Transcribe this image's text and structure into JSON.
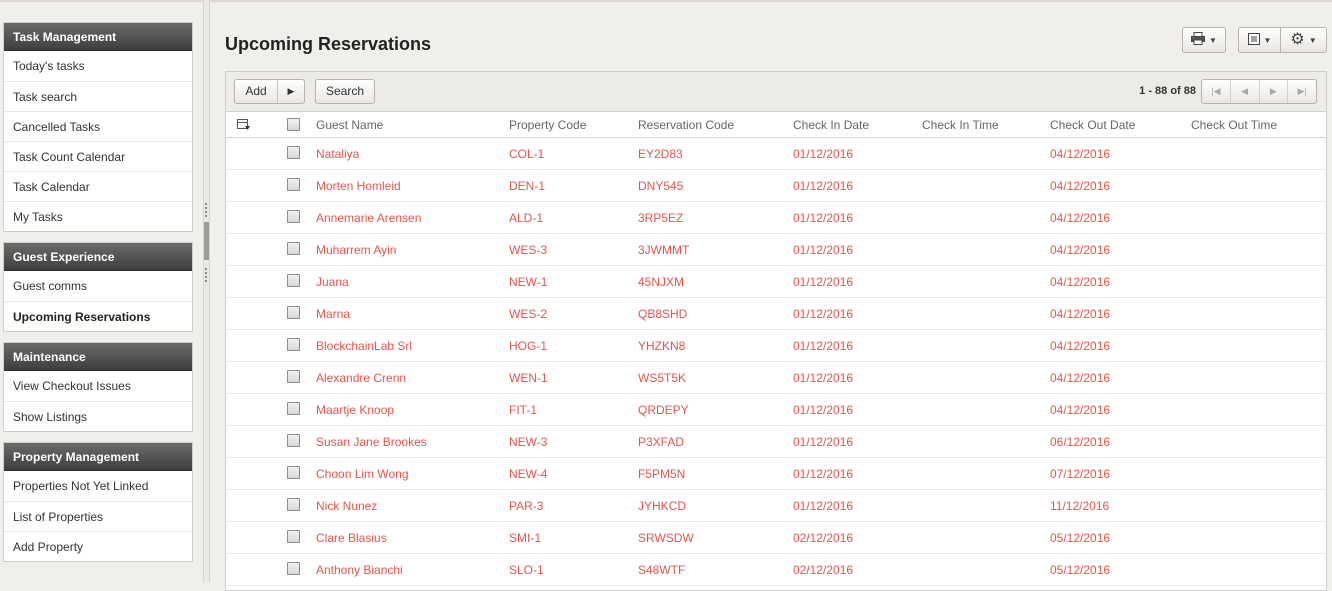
{
  "sidebar": {
    "sections": [
      {
        "title": "Task Management",
        "items": [
          "Today's tasks",
          "Task search",
          "Cancelled Tasks",
          "Task Count Calendar",
          "Task Calendar",
          "My Tasks"
        ]
      },
      {
        "title": "Guest Experience",
        "items": [
          "Guest comms",
          "Upcoming Reservations"
        ]
      },
      {
        "title": "Maintenance",
        "items": [
          "View Checkout Issues",
          "Show Listings"
        ]
      },
      {
        "title": "Property Management",
        "items": [
          "Properties Not Yet Linked",
          "List of Properties",
          "Add Property"
        ]
      }
    ],
    "active_item": "Upcoming Reservations"
  },
  "main": {
    "title": "Upcoming Reservations",
    "toolbar": {
      "add_label": "Add",
      "search_label": "Search"
    },
    "pager": {
      "text": "1 - 88 of 88"
    },
    "columns": [
      "Guest Name",
      "Property Code",
      "Reservation Code",
      "Check In Date",
      "Check In Time",
      "Check Out Date",
      "Check Out Time"
    ],
    "rows": [
      {
        "guest": "Nataliya",
        "property": "COL-1",
        "reservation": "EY2D83",
        "check_in": "01/12/2016",
        "check_in_time": "",
        "check_out": "04/12/2016",
        "check_out_time": ""
      },
      {
        "guest": "Morten Homleid",
        "property": "DEN-1",
        "reservation": "DNY545",
        "check_in": "01/12/2016",
        "check_in_time": "",
        "check_out": "04/12/2016",
        "check_out_time": ""
      },
      {
        "guest": "Annemarie Arensen",
        "property": "ALD-1",
        "reservation": "3RP5EZ",
        "check_in": "01/12/2016",
        "check_in_time": "",
        "check_out": "04/12/2016",
        "check_out_time": ""
      },
      {
        "guest": "Muharrem Ayin",
        "property": "WES-3",
        "reservation": "3JWMMT",
        "check_in": "01/12/2016",
        "check_in_time": "",
        "check_out": "04/12/2016",
        "check_out_time": ""
      },
      {
        "guest": "Juana",
        "property": "NEW-1",
        "reservation": "45NJXM",
        "check_in": "01/12/2016",
        "check_in_time": "",
        "check_out": "04/12/2016",
        "check_out_time": ""
      },
      {
        "guest": "Marna",
        "property": "WES-2",
        "reservation": "QB8SHD",
        "check_in": "01/12/2016",
        "check_in_time": "",
        "check_out": "04/12/2016",
        "check_out_time": ""
      },
      {
        "guest": "BlockchainLab Srl",
        "property": "HOG-1",
        "reservation": "YHZKN8",
        "check_in": "01/12/2016",
        "check_in_time": "",
        "check_out": "04/12/2016",
        "check_out_time": ""
      },
      {
        "guest": "Alexandre Crenn",
        "property": "WEN-1",
        "reservation": "WS5T5K",
        "check_in": "01/12/2016",
        "check_in_time": "",
        "check_out": "04/12/2016",
        "check_out_time": ""
      },
      {
        "guest": "Maartje Knoop",
        "property": "FIT-1",
        "reservation": "QRDEPY",
        "check_in": "01/12/2016",
        "check_in_time": "",
        "check_out": "04/12/2016",
        "check_out_time": ""
      },
      {
        "guest": "Susan Jane Brookes",
        "property": "NEW-3",
        "reservation": "P3XFAD",
        "check_in": "01/12/2016",
        "check_in_time": "",
        "check_out": "06/12/2016",
        "check_out_time": ""
      },
      {
        "guest": "Choon Lim Wong",
        "property": "NEW-4",
        "reservation": "F5PM5N",
        "check_in": "01/12/2016",
        "check_in_time": "",
        "check_out": "07/12/2016",
        "check_out_time": ""
      },
      {
        "guest": "Nick Nunez",
        "property": "PAR-3",
        "reservation": "JYHKCD",
        "check_in": "01/12/2016",
        "check_in_time": "",
        "check_out": "11/12/2016",
        "check_out_time": ""
      },
      {
        "guest": "Clare Blasius",
        "property": "SMI-1",
        "reservation": "SRWSDW",
        "check_in": "02/12/2016",
        "check_in_time": "",
        "check_out": "05/12/2016",
        "check_out_time": ""
      },
      {
        "guest": "Anthony Bianchi",
        "property": "SLO-1",
        "reservation": "S48WTF",
        "check_in": "02/12/2016",
        "check_in_time": "",
        "check_out": "05/12/2016",
        "check_out_time": ""
      }
    ]
  },
  "icons": {
    "print": "print-icon",
    "view": "list-view-icon",
    "settings": "gear-icon",
    "column_chooser": "column-chooser-icon",
    "pager_first": "first-page-icon",
    "pager_prev": "prev-page-icon",
    "pager_next": "next-page-icon",
    "pager_last": "last-page-icon"
  },
  "colors": {
    "row_text": "#e0574f",
    "panel_header": "#4a4a4a",
    "background": "#f1efeb"
  }
}
